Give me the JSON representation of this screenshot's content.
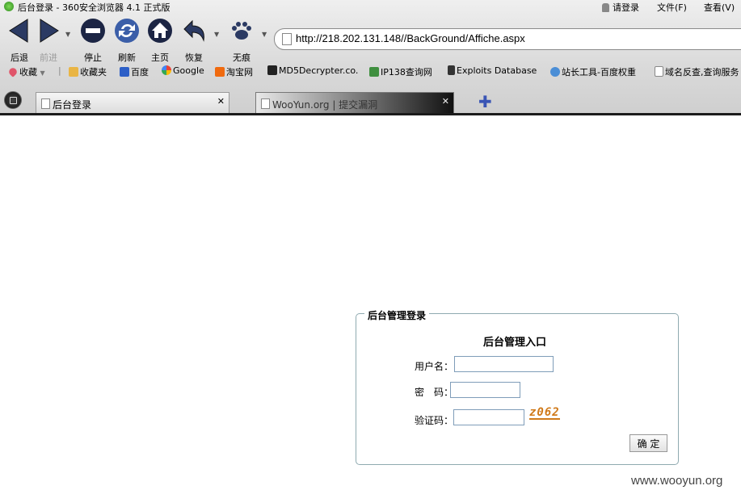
{
  "window": {
    "title": "后台登录 - 360安全浏览器 4.1 正式版",
    "menu": [
      "请登录",
      "文件(F)",
      "查看(V)"
    ]
  },
  "nav": {
    "back": "后退",
    "forward": "前进",
    "stop": "停止",
    "refresh": "刷新",
    "home": "主页",
    "restore": "恢复",
    "incognito": "无痕"
  },
  "address": {
    "url": "http://218.202.131.148//BackGround/Affiche.aspx"
  },
  "bookmarks": {
    "favorites": "收藏",
    "folder": "收藏夹",
    "items": [
      "百度",
      "Google",
      "淘宝网",
      "MD5Decrypter.co.",
      "IP138查询网",
      "Exploits Database",
      "站长工具-百度权重",
      "域名反查,查询服务"
    ]
  },
  "tabs": [
    {
      "label": "后台登录",
      "active": true
    },
    {
      "label": "WooYun.org | 提交漏洞",
      "active": false
    }
  ],
  "login": {
    "legend": "后台管理登录",
    "heading": "后台管理入口",
    "username_label": "用户名：",
    "username_value": "",
    "password_label": "密　码：",
    "password_value": "",
    "captcha_label": "验证码：",
    "captcha_value": "",
    "captcha_text": "z062",
    "submit": "确 定"
  },
  "watermark": "www.wooyun.org",
  "colors": {
    "accent": "#3a55b5",
    "captcha": "#d07a1a",
    "box_border": "#8faab0"
  }
}
